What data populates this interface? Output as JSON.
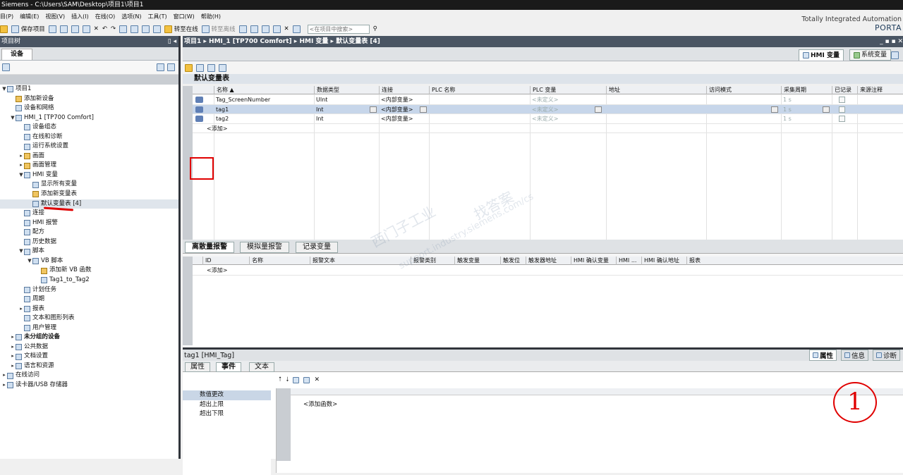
{
  "window": {
    "title": "Siemens  -  C:\\Users\\SAM\\Desktop\\项目1\\项目1"
  },
  "menu": [
    "目(P)",
    "编辑(E)",
    "视图(V)",
    "插入(I)",
    "在线(O)",
    "选项(N)",
    "工具(T)",
    "窗口(W)",
    "帮助(H)"
  ],
  "toolbar": {
    "save": "保存项目",
    "go_online": "转至在线",
    "go_offline": "转至离线",
    "search_placeholder": "<在项目中搜索>"
  },
  "brand": {
    "line1": "Totally Integrated Automation",
    "line2": "PORTA"
  },
  "project_tree": {
    "header": "项目树",
    "tab": "设备",
    "items": [
      {
        "label": "项目1",
        "arrow": "▼",
        "indent": 0
      },
      {
        "label": "添加新设备",
        "arrow": "",
        "indent": 1
      },
      {
        "label": "设备和网络",
        "arrow": "",
        "indent": 1
      },
      {
        "label": "HMI_1 [TP700 Comfort]",
        "arrow": "▼",
        "indent": 1
      },
      {
        "label": "设备组态",
        "arrow": "",
        "indent": 2
      },
      {
        "label": "在线和诊断",
        "arrow": "",
        "indent": 2
      },
      {
        "label": "运行系统设置",
        "arrow": "",
        "indent": 2
      },
      {
        "label": "画面",
        "arrow": "▸",
        "indent": 2
      },
      {
        "label": "画面管理",
        "arrow": "▸",
        "indent": 2
      },
      {
        "label": "HMI 变量",
        "arrow": "▼",
        "indent": 2
      },
      {
        "label": "显示所有变量",
        "arrow": "",
        "indent": 3
      },
      {
        "label": "添加新变量表",
        "arrow": "",
        "indent": 3
      },
      {
        "label": "默认变量表 [4]",
        "arrow": "",
        "indent": 3
      },
      {
        "label": "连接",
        "arrow": "",
        "indent": 2
      },
      {
        "label": "HMI 报警",
        "arrow": "",
        "indent": 2
      },
      {
        "label": "配方",
        "arrow": "",
        "indent": 2
      },
      {
        "label": "历史数据",
        "arrow": "",
        "indent": 2
      },
      {
        "label": "脚本",
        "arrow": "▼",
        "indent": 2
      },
      {
        "label": "VB 脚本",
        "arrow": "▼",
        "indent": 3
      },
      {
        "label": "添加新 VB 函数",
        "arrow": "",
        "indent": 4
      },
      {
        "label": "Tag1_to_Tag2",
        "arrow": "",
        "indent": 4
      },
      {
        "label": "计划任务",
        "arrow": "",
        "indent": 2
      },
      {
        "label": "周期",
        "arrow": "",
        "indent": 2
      },
      {
        "label": "报表",
        "arrow": "▸",
        "indent": 2
      },
      {
        "label": "文本和图形列表",
        "arrow": "",
        "indent": 2
      },
      {
        "label": "用户管理",
        "arrow": "",
        "indent": 2
      },
      {
        "label": "未分组的设备",
        "arrow": "▸",
        "indent": 1
      },
      {
        "label": "公共数据",
        "arrow": "▸",
        "indent": 1
      },
      {
        "label": "文档设置",
        "arrow": "▸",
        "indent": 1
      },
      {
        "label": "语言和资源",
        "arrow": "▸",
        "indent": 1
      },
      {
        "label": "在线访问",
        "arrow": "▸",
        "indent": 0
      },
      {
        "label": "读卡器/USB 存储器",
        "arrow": "▸",
        "indent": 0
      }
    ]
  },
  "editor": {
    "breadcrumb": "项目1  ▸  HMI_1 [TP700 Comfort]  ▸  HMI 变量  ▸  默认变量表 [4]",
    "tab_hmi": "HMI 变量",
    "tab_system": "系统变量",
    "table_title": "默认变量表",
    "columns": [
      "名称 ▲",
      "数据类型",
      "连接",
      "PLC 名称",
      "PLC 变量",
      "地址",
      "访问模式",
      "采集周期",
      "已记录",
      "来源注释"
    ],
    "rows": [
      {
        "name": "Tag_ScreenNumber",
        "type": "UInt",
        "conn": "<内部变量>",
        "plc_var": "<未定义>",
        "cycle": "1 s"
      },
      {
        "name": "tag1",
        "type": "Int",
        "conn": "<内部变量>",
        "plc_var": "<未定义>",
        "cycle": "1 s"
      },
      {
        "name": "tag2",
        "type": "Int",
        "conn": "<内部变量>",
        "plc_var": "<未定义>",
        "cycle": "1 s"
      }
    ],
    "add_row": "<添加>"
  },
  "alarms": {
    "tabs": [
      "离散量报警",
      "模拟量报警",
      "记录变量"
    ],
    "columns": [
      "ID",
      "名称",
      "报警文本",
      "报警类别",
      "触发变量",
      "触发位",
      "触发器地址",
      "HMI 确认变量",
      "HMI ...",
      "HMI 确认地址",
      "报表"
    ],
    "add_row": "<添加>"
  },
  "properties": {
    "title": "tag1 [HMI_Tag]",
    "inspector_tabs": [
      "属性",
      "信息",
      "诊断"
    ],
    "tabs": [
      "属性",
      "事件",
      "文本"
    ],
    "events": [
      "数值更改",
      "超出上限",
      "超出下限"
    ],
    "add_function": "<添加函数>"
  },
  "annotation": {
    "circle_text": "1"
  },
  "watermark": [
    "西门子工业",
    "找答案",
    "support.industry.siemens.com/cs"
  ]
}
